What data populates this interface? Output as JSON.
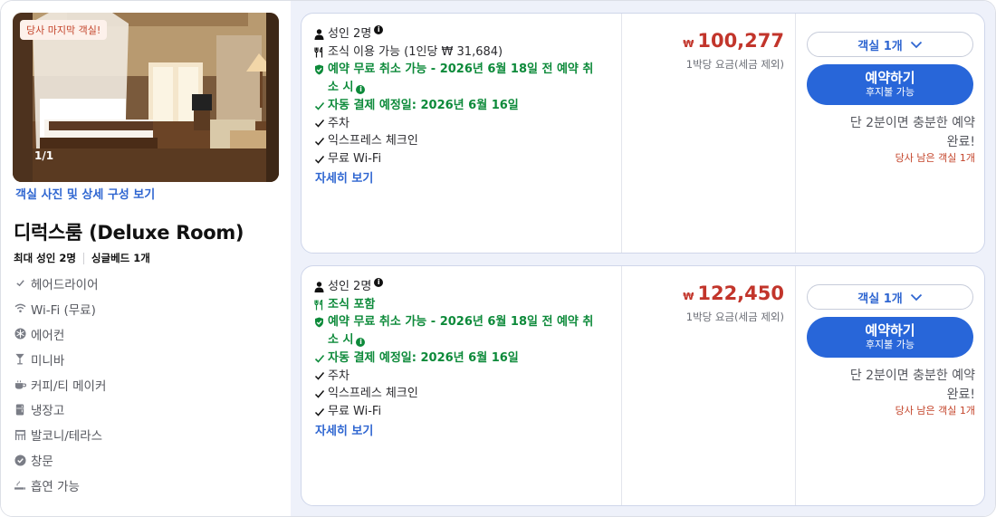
{
  "room": {
    "last_room_badge": "당사 마지막 객실!",
    "photo_counter": "1/1",
    "photo_link": "객실 사진 및 상세 구성 보기",
    "title": "디럭스룸 (Deluxe Room)",
    "max_guests": "최대 성인 2명",
    "bed": "싱글베드 1개",
    "amenities": [
      {
        "icon": "check-icon",
        "label": "헤어드라이어"
      },
      {
        "icon": "wifi-icon",
        "label": "Wi-Fi (무료)"
      },
      {
        "icon": "snowflake-icon",
        "label": "에어컨"
      },
      {
        "icon": "cocktail-icon",
        "label": "미니바"
      },
      {
        "icon": "coffee-cup-icon",
        "label": "커피/티 메이커"
      },
      {
        "icon": "fridge-icon",
        "label": "냉장고"
      },
      {
        "icon": "balcony-icon",
        "label": "발코니/테라스"
      },
      {
        "icon": "check-circle-icon",
        "label": "창문"
      },
      {
        "icon": "smoking-icon",
        "label": "흡연 가능"
      }
    ]
  },
  "offers": [
    {
      "guests": "성인 2명",
      "meal": "조식 이용 가능 (1인당 ₩ 31,684)",
      "meal_included": false,
      "cancel_line1": "예약 무료 취소 가능 - 2026년 6월 18일 전 예약 취",
      "cancel_line2": "소 시",
      "payment": "자동 결제 예정일: 2026년 6월 16일",
      "features": [
        "주차",
        "익스프레스 체크인",
        "무료 Wi-Fi"
      ],
      "details_link": "자세히 보기",
      "currency": "₩",
      "price": "100,277",
      "price_note": "1박당 요금(세금 제외)",
      "room_select": "객실 1개",
      "book_label": "예약하기",
      "book_sub": "후지불 가능",
      "quick_line1": "단 2분이면 충분한 예약",
      "quick_line2": "완료!",
      "rooms_left": "당사 남은 객실 1개"
    },
    {
      "guests": "성인 2명",
      "meal": "조식 포함",
      "meal_included": true,
      "cancel_line1": "예약 무료 취소 가능 - 2026년 6월 18일 전 예약 취",
      "cancel_line2": "소 시",
      "payment": "자동 결제 예정일: 2026년 6월 16일",
      "features": [
        "주차",
        "익스프레스 체크인",
        "무료 Wi-Fi"
      ],
      "details_link": "자세히 보기",
      "currency": "₩",
      "price": "122,450",
      "price_note": "1박당 요금(세금 제외)",
      "room_select": "객실 1개",
      "book_label": "예약하기",
      "book_sub": "후지불 가능",
      "quick_line1": "단 2분이면 충분한 예약",
      "quick_line2": "완료!",
      "rooms_left": "당사 남은 객실 1개"
    }
  ],
  "colors": {
    "accent_blue": "#2866d9",
    "price_red": "#c2352b",
    "green": "#0d8a3a",
    "panel_bg": "#eef1fa"
  }
}
